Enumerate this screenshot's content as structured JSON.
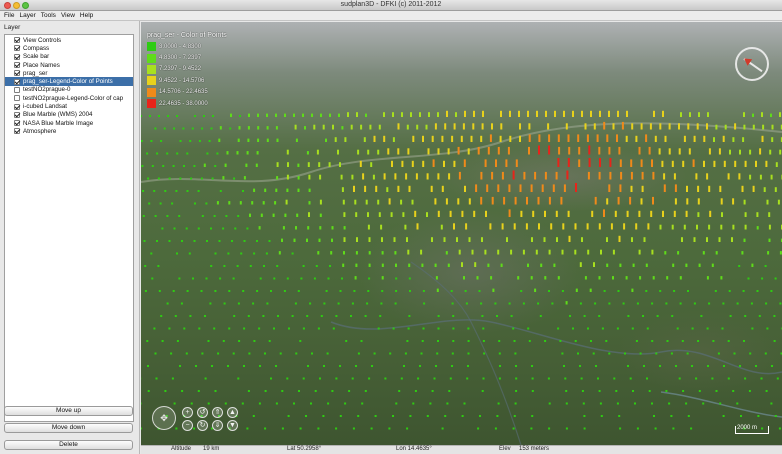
{
  "window": {
    "title": "sudplan3D - DFKI (c) 2011-2012"
  },
  "menu": [
    "File",
    "Layer",
    "Tools",
    "View",
    "Help"
  ],
  "panel": {
    "label": "Layer"
  },
  "layers": [
    {
      "label": "View Controls",
      "checked": true,
      "selected": false
    },
    {
      "label": "Compass",
      "checked": true,
      "selected": false
    },
    {
      "label": "Scale bar",
      "checked": true,
      "selected": false
    },
    {
      "label": "Place Names",
      "checked": true,
      "selected": false
    },
    {
      "label": "prag_ser",
      "checked": true,
      "selected": false
    },
    {
      "label": "prag_ser-Legend-Color of Points",
      "checked": true,
      "selected": true
    },
    {
      "label": "testNO2prague-0",
      "checked": false,
      "selected": false
    },
    {
      "label": "testNO2prague-Legend-Color of cap",
      "checked": false,
      "selected": false
    },
    {
      "label": "i-cubed Landsat",
      "checked": true,
      "selected": false
    },
    {
      "label": "Blue Marble (WMS) 2004",
      "checked": true,
      "selected": false
    },
    {
      "label": "NASA Blue Marble Image",
      "checked": true,
      "selected": false
    },
    {
      "label": "Atmosphere",
      "checked": true,
      "selected": false
    }
  ],
  "buttons": {
    "move_up": "Move up",
    "move_down": "Move down",
    "delete": "Delete"
  },
  "legend": {
    "title": "prag_ser - Color of Points",
    "entries": [
      {
        "label": "3.0000 - 4.8300",
        "color": "#2ecc12"
      },
      {
        "label": "4.8300 - 7.2397",
        "color": "#5fdc1a"
      },
      {
        "label": "7.2397 - 9.4522",
        "color": "#a8e01f"
      },
      {
        "label": "9.4522 - 14.5706",
        "color": "#e8d21c"
      },
      {
        "label": "14.5706 - 22.4635",
        "color": "#f08a1a"
      },
      {
        "label": "22.4635 - 38.0000",
        "color": "#e8241a"
      }
    ]
  },
  "scale": {
    "label": "2000 m"
  },
  "status": {
    "altitude_label": "Altitude",
    "altitude_value": "19 km",
    "lat": "Lat 50.2958°",
    "lon": "Lon 14.4635°",
    "elev_label": "Elev",
    "elev_value": "153 meters"
  },
  "icons": {
    "pan": "pan-control-icon",
    "zoom_in": "zoom-in-icon",
    "zoom_out": "zoom-out-icon",
    "rotate_left": "rotate-left-icon",
    "rotate_right": "rotate-right-icon",
    "tilt_up": "tilt-up-icon",
    "tilt_down": "tilt-down-icon",
    "ve_up": "exaggeration-up-icon",
    "ve_down": "exaggeration-down-icon",
    "compass": "compass-icon"
  }
}
